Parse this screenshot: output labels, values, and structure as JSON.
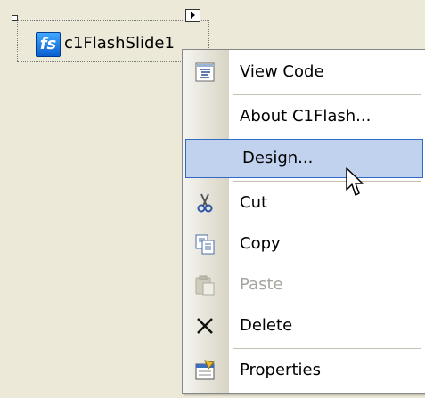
{
  "component": {
    "label": "c1FlashSlide1",
    "icon_text": "fs",
    "icon": "flash-slide-icon"
  },
  "smart_tag": {
    "icon": "smart-tag-arrow-icon"
  },
  "menu": {
    "items": [
      {
        "label": "View Code",
        "icon": "view-code-icon",
        "disabled": false
      },
      {
        "label": "About C1Flash...",
        "icon": "",
        "disabled": false
      },
      {
        "label": "Design...",
        "icon": "",
        "disabled": false,
        "highlighted": true
      },
      {
        "label": "Cut",
        "icon": "scissors-icon",
        "disabled": false
      },
      {
        "label": "Copy",
        "icon": "copy-icon",
        "disabled": false
      },
      {
        "label": "Paste",
        "icon": "paste-icon",
        "disabled": true
      },
      {
        "label": "Delete",
        "icon": "delete-x-icon",
        "disabled": false
      },
      {
        "label": "Properties",
        "icon": "properties-icon",
        "disabled": false
      }
    ]
  },
  "colors": {
    "background": "#ece9d8",
    "highlight_fill": "#c1d2ee",
    "highlight_border": "#316ac5",
    "disabled_text": "#a6a59d"
  }
}
